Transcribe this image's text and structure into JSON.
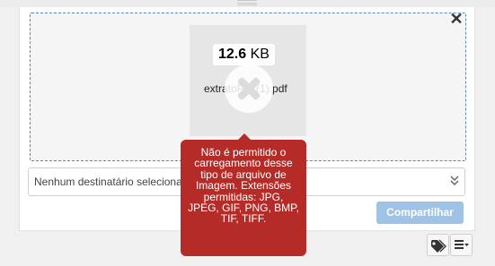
{
  "upload": {
    "file_size_value": "12.6",
    "file_size_unit": "KB",
    "file_name": "extratoPdf (1).pdf",
    "remove_icon": "close-icon",
    "error_icon": "cross-icon"
  },
  "error_tooltip": {
    "message": "Não é permitido o carregamento desse tipo de arquivo de Imagem. Extensões permitidas: JPG, JPEG, GIF, PNG, BMP, TIF, TIFF."
  },
  "recipient": {
    "value": "Nenhum destinatário selecionado"
  },
  "actions": {
    "share_label": "Compartilhar"
  },
  "toolbar": {
    "tag_icon": "tag-icon",
    "menu_icon": "list-menu-icon"
  },
  "colors": {
    "tooltip_bg": "#b52b27",
    "share_disabled_bg": "#9fc3e6",
    "dropzone_border": "#5b88b5"
  }
}
